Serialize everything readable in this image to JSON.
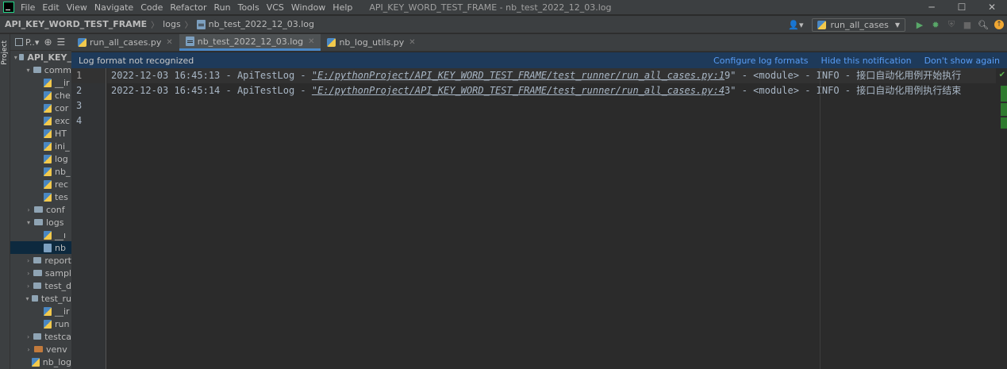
{
  "menu": {
    "items": [
      "File",
      "Edit",
      "View",
      "Navigate",
      "Code",
      "Refactor",
      "Run",
      "Tools",
      "VCS",
      "Window",
      "Help"
    ],
    "window_title": "API_KEY_WORD_TEST_FRAME - nb_test_2022_12_03.log"
  },
  "window_controls": {
    "minimize": "─",
    "maximize": "☐",
    "close": "✕"
  },
  "navbar": {
    "breadcrumb": [
      "API_KEY_WORD_TEST_FRAME",
      "logs",
      "nb_test_2022_12_03.log"
    ],
    "vcs_icon": "👤▾",
    "run_config": "run_all_cases"
  },
  "left_strip": {
    "label": "Project"
  },
  "project_panel": {
    "header_label": "P..▾",
    "tree": [
      {
        "label": "API_KEY_",
        "arrow": "▾",
        "kind": "folder",
        "depth": 0,
        "bold": true
      },
      {
        "label": "comm",
        "arrow": "▾",
        "kind": "folder",
        "depth": 1
      },
      {
        "label": "__ir",
        "arrow": "",
        "kind": "py",
        "depth": 2
      },
      {
        "label": "che",
        "arrow": "",
        "kind": "py",
        "depth": 2
      },
      {
        "label": "cor",
        "arrow": "",
        "kind": "py",
        "depth": 2
      },
      {
        "label": "exc",
        "arrow": "",
        "kind": "py",
        "depth": 2
      },
      {
        "label": "HT",
        "arrow": "",
        "kind": "py",
        "depth": 2
      },
      {
        "label": "ini_",
        "arrow": "",
        "kind": "py",
        "depth": 2
      },
      {
        "label": "log",
        "arrow": "",
        "kind": "py",
        "depth": 2
      },
      {
        "label": "nb_",
        "arrow": "",
        "kind": "py",
        "depth": 2
      },
      {
        "label": "rec",
        "arrow": "",
        "kind": "py",
        "depth": 2
      },
      {
        "label": "tes",
        "arrow": "",
        "kind": "py",
        "depth": 2
      },
      {
        "label": "conf",
        "arrow": "›",
        "kind": "folder",
        "depth": 1
      },
      {
        "label": "logs",
        "arrow": "▾",
        "kind": "folder",
        "depth": 1
      },
      {
        "label": "__ı",
        "arrow": "",
        "kind": "py",
        "depth": 2
      },
      {
        "label": "nb",
        "arrow": "",
        "kind": "log",
        "depth": 2,
        "selected": true
      },
      {
        "label": "report",
        "arrow": "›",
        "kind": "folder",
        "depth": 1
      },
      {
        "label": "sampl",
        "arrow": "›",
        "kind": "folder",
        "depth": 1
      },
      {
        "label": "test_d",
        "arrow": "›",
        "kind": "folder",
        "depth": 1
      },
      {
        "label": "test_ru",
        "arrow": "▾",
        "kind": "folder",
        "depth": 1
      },
      {
        "label": "__ir",
        "arrow": "",
        "kind": "py",
        "depth": 2
      },
      {
        "label": "run",
        "arrow": "",
        "kind": "py",
        "depth": 2
      },
      {
        "label": "testca",
        "arrow": "›",
        "kind": "folder",
        "depth": 1
      },
      {
        "label": "venv",
        "arrow": "›",
        "kind": "venv",
        "depth": 1
      },
      {
        "label": "nb_log",
        "arrow": "",
        "kind": "py",
        "depth": 1
      }
    ]
  },
  "tabs": [
    {
      "label": "run_all_cases.py",
      "icon": "py",
      "active": false
    },
    {
      "label": "nb_test_2022_12_03.log",
      "icon": "log",
      "active": true
    },
    {
      "label": "nb_log_utils.py",
      "icon": "py",
      "active": false
    }
  ],
  "notification": {
    "message": "Log format not recognized",
    "actions": [
      "Configure log formats",
      "Hide this notification",
      "Don't show again"
    ]
  },
  "editor": {
    "line_numbers": [
      "1",
      "2",
      "3",
      "4"
    ],
    "lines": [
      {
        "prefix": "2022-12-03 16:45:13 - ApiTestLog - ",
        "link": "\"E:/pythonProject/API_KEY_WORD_TEST_FRAME/test_runner/run_all_cases.py:1",
        "suffix": "9\" - <module> - INFO - 接口自动化用例开始执行"
      },
      {
        "prefix": "2022-12-03 16:45:14 - ApiTestLog - ",
        "link": "\"E:/pythonProject/API_KEY_WORD_TEST_FRAME/test_runner/run_all_cases.py:4",
        "suffix": "3\" - <module> - INFO - 接口自动化用例执行结束"
      },
      {
        "prefix": "",
        "link": "",
        "suffix": ""
      },
      {
        "prefix": "",
        "link": "",
        "suffix": ""
      }
    ],
    "current_line_index": 0,
    "inspection_icon": "check-icon"
  }
}
